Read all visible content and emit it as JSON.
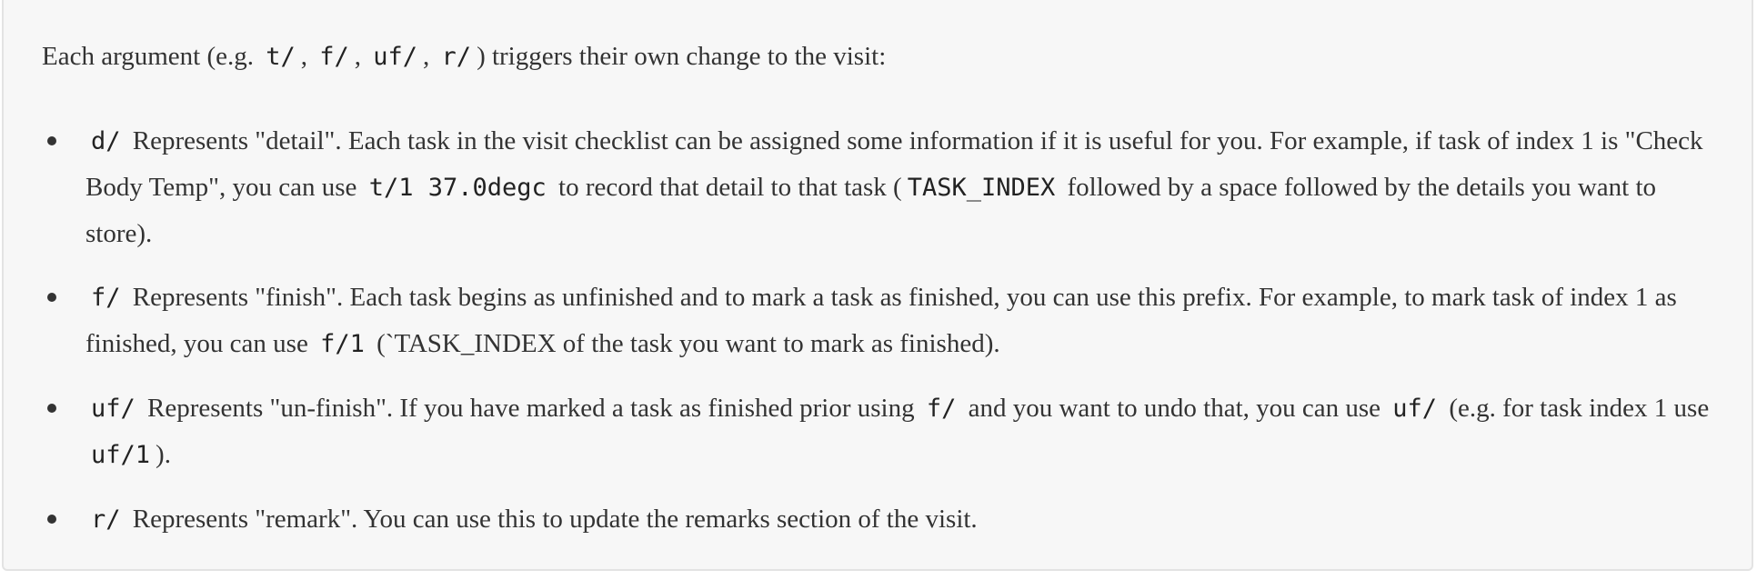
{
  "intro": {
    "before": "Each argument (e.g. ",
    "code1": "t/",
    "sep1": ", ",
    "code2": "f/",
    "sep2": ", ",
    "code3": "uf/",
    "sep3": ", ",
    "code4": "r/",
    "after": ") triggers their own change to the visit:"
  },
  "items": [
    {
      "prefix": "d/",
      "text1": "Represents \"detail\". Each task in the visit checklist can be assigned some information if it is useful for you. For example, if task of index 1 is \"Check Body Temp\", you can use ",
      "code1": "t/1 37.0degc",
      "text2": " to record that detail to that task (",
      "code2": "TASK_INDEX",
      "text3": " followed by a space followed by the details you want to store)."
    },
    {
      "prefix": "f/",
      "text1": "Represents \"finish\". Each task begins as unfinished and to mark a task as finished, you can use this prefix. For example, to mark task of index 1 as finished, you can use ",
      "code1": "f/1",
      "text2": " (`TASK_INDEX of the task you want to mark as finished)."
    },
    {
      "prefix": "uf/",
      "text1": "Represents \"un-finish\". If you have marked a task as finished prior using ",
      "code1": "f/",
      "text2": " and you want to undo that, you can use ",
      "code2": "uf/",
      "text3": " (e.g. for task index 1 use ",
      "code3": "uf/1",
      "text4": ")."
    },
    {
      "prefix": "r/",
      "text1": "Represents \"remark\". You can use this to update the remarks section of the visit."
    }
  ]
}
